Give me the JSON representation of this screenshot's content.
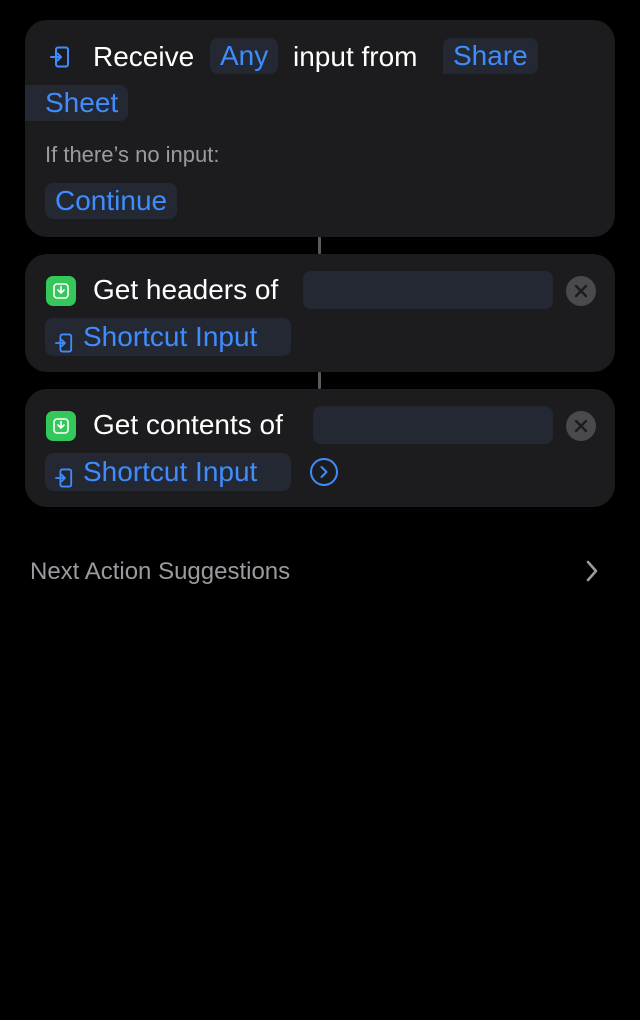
{
  "actions": {
    "receive": {
      "verb": "Receive",
      "type_token": "Any",
      "middle_text": "input from",
      "source_line1": "Share",
      "source_line2": "Sheet",
      "fallback_label": "If there’s no input:",
      "fallback_value": "Continue",
      "icon": "shortcut-input-icon"
    },
    "get_headers": {
      "title": "Get headers of",
      "variable": "Shortcut Input",
      "icon": "download-icon",
      "clear_icon": "clear-x-icon"
    },
    "get_contents": {
      "title": "Get contents of",
      "variable": "Shortcut Input",
      "icon": "download-icon",
      "clear_icon": "clear-x-icon",
      "expand_icon": "chevron-circle-icon"
    }
  },
  "suggestions": {
    "label": "Next Action Suggestions",
    "icon": "chevron-right-icon"
  },
  "colors": {
    "background": "#000000",
    "card": "#1c1c1e",
    "accent": "#3f8cff",
    "token_bg": "#232833",
    "action_icon": "#34c759",
    "secondary_text": "#9a9aa0"
  }
}
